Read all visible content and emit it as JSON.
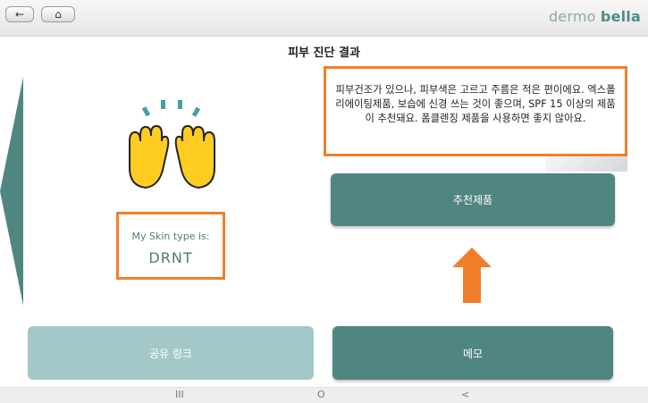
{
  "toolbar": {
    "back_icon": "←",
    "home_icon": "⌂"
  },
  "logo": {
    "part1": "dermo ",
    "part2": "bella"
  },
  "page_title": "피부 진단 결과",
  "skin": {
    "label": "My Skin type is:",
    "type": "DRNT"
  },
  "result_text": "피부건조가 있으나, 피부색은 고르고 주름은 적은 편이에요. 엑스폴리에이팅제품, 보습에 신경 쓰는 것이 좋으며, SPF 15 이상의 제품이 추천돼요. 폼클렌징 제품을 사용하면 좋지 않아요.",
  "buttons": {
    "recommend": "추천제품",
    "share": "공유 링크",
    "memo": "메모"
  },
  "system_nav": {
    "recent": "III",
    "home": "O",
    "back": "<"
  },
  "colors": {
    "accent": "#4f8682",
    "highlight": "#f07f2a",
    "disabled": "#a4c8c8"
  }
}
